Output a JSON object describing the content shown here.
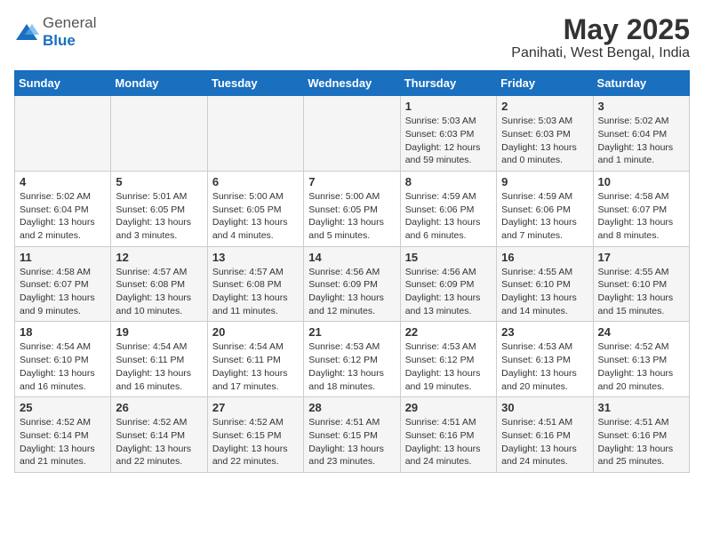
{
  "header": {
    "logo": {
      "general": "General",
      "blue": "Blue"
    },
    "title": "May 2025",
    "subtitle": "Panihati, West Bengal, India"
  },
  "calendar": {
    "weekdays": [
      "Sunday",
      "Monday",
      "Tuesday",
      "Wednesday",
      "Thursday",
      "Friday",
      "Saturday"
    ],
    "weeks": [
      [
        {
          "day": "",
          "info": ""
        },
        {
          "day": "",
          "info": ""
        },
        {
          "day": "",
          "info": ""
        },
        {
          "day": "",
          "info": ""
        },
        {
          "day": "1",
          "info": "Sunrise: 5:03 AM\nSunset: 6:03 PM\nDaylight: 12 hours\nand 59 minutes."
        },
        {
          "day": "2",
          "info": "Sunrise: 5:03 AM\nSunset: 6:03 PM\nDaylight: 13 hours\nand 0 minutes."
        },
        {
          "day": "3",
          "info": "Sunrise: 5:02 AM\nSunset: 6:04 PM\nDaylight: 13 hours\nand 1 minute."
        }
      ],
      [
        {
          "day": "4",
          "info": "Sunrise: 5:02 AM\nSunset: 6:04 PM\nDaylight: 13 hours\nand 2 minutes."
        },
        {
          "day": "5",
          "info": "Sunrise: 5:01 AM\nSunset: 6:05 PM\nDaylight: 13 hours\nand 3 minutes."
        },
        {
          "day": "6",
          "info": "Sunrise: 5:00 AM\nSunset: 6:05 PM\nDaylight: 13 hours\nand 4 minutes."
        },
        {
          "day": "7",
          "info": "Sunrise: 5:00 AM\nSunset: 6:05 PM\nDaylight: 13 hours\nand 5 minutes."
        },
        {
          "day": "8",
          "info": "Sunrise: 4:59 AM\nSunset: 6:06 PM\nDaylight: 13 hours\nand 6 minutes."
        },
        {
          "day": "9",
          "info": "Sunrise: 4:59 AM\nSunset: 6:06 PM\nDaylight: 13 hours\nand 7 minutes."
        },
        {
          "day": "10",
          "info": "Sunrise: 4:58 AM\nSunset: 6:07 PM\nDaylight: 13 hours\nand 8 minutes."
        }
      ],
      [
        {
          "day": "11",
          "info": "Sunrise: 4:58 AM\nSunset: 6:07 PM\nDaylight: 13 hours\nand 9 minutes."
        },
        {
          "day": "12",
          "info": "Sunrise: 4:57 AM\nSunset: 6:08 PM\nDaylight: 13 hours\nand 10 minutes."
        },
        {
          "day": "13",
          "info": "Sunrise: 4:57 AM\nSunset: 6:08 PM\nDaylight: 13 hours\nand 11 minutes."
        },
        {
          "day": "14",
          "info": "Sunrise: 4:56 AM\nSunset: 6:09 PM\nDaylight: 13 hours\nand 12 minutes."
        },
        {
          "day": "15",
          "info": "Sunrise: 4:56 AM\nSunset: 6:09 PM\nDaylight: 13 hours\nand 13 minutes."
        },
        {
          "day": "16",
          "info": "Sunrise: 4:55 AM\nSunset: 6:10 PM\nDaylight: 13 hours\nand 14 minutes."
        },
        {
          "day": "17",
          "info": "Sunrise: 4:55 AM\nSunset: 6:10 PM\nDaylight: 13 hours\nand 15 minutes."
        }
      ],
      [
        {
          "day": "18",
          "info": "Sunrise: 4:54 AM\nSunset: 6:10 PM\nDaylight: 13 hours\nand 16 minutes."
        },
        {
          "day": "19",
          "info": "Sunrise: 4:54 AM\nSunset: 6:11 PM\nDaylight: 13 hours\nand 16 minutes."
        },
        {
          "day": "20",
          "info": "Sunrise: 4:54 AM\nSunset: 6:11 PM\nDaylight: 13 hours\nand 17 minutes."
        },
        {
          "day": "21",
          "info": "Sunrise: 4:53 AM\nSunset: 6:12 PM\nDaylight: 13 hours\nand 18 minutes."
        },
        {
          "day": "22",
          "info": "Sunrise: 4:53 AM\nSunset: 6:12 PM\nDaylight: 13 hours\nand 19 minutes."
        },
        {
          "day": "23",
          "info": "Sunrise: 4:53 AM\nSunset: 6:13 PM\nDaylight: 13 hours\nand 20 minutes."
        },
        {
          "day": "24",
          "info": "Sunrise: 4:52 AM\nSunset: 6:13 PM\nDaylight: 13 hours\nand 20 minutes."
        }
      ],
      [
        {
          "day": "25",
          "info": "Sunrise: 4:52 AM\nSunset: 6:14 PM\nDaylight: 13 hours\nand 21 minutes."
        },
        {
          "day": "26",
          "info": "Sunrise: 4:52 AM\nSunset: 6:14 PM\nDaylight: 13 hours\nand 22 minutes."
        },
        {
          "day": "27",
          "info": "Sunrise: 4:52 AM\nSunset: 6:15 PM\nDaylight: 13 hours\nand 22 minutes."
        },
        {
          "day": "28",
          "info": "Sunrise: 4:51 AM\nSunset: 6:15 PM\nDaylight: 13 hours\nand 23 minutes."
        },
        {
          "day": "29",
          "info": "Sunrise: 4:51 AM\nSunset: 6:16 PM\nDaylight: 13 hours\nand 24 minutes."
        },
        {
          "day": "30",
          "info": "Sunrise: 4:51 AM\nSunset: 6:16 PM\nDaylight: 13 hours\nand 24 minutes."
        },
        {
          "day": "31",
          "info": "Sunrise: 4:51 AM\nSunset: 6:16 PM\nDaylight: 13 hours\nand 25 minutes."
        }
      ]
    ]
  }
}
